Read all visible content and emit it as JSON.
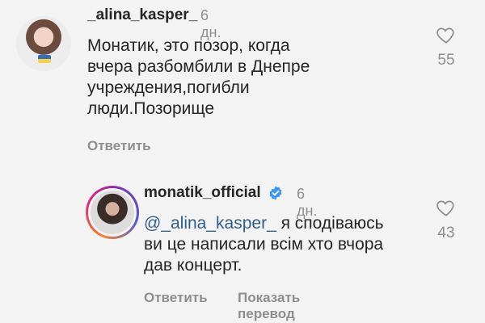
{
  "comment1": {
    "username": "_alina_kasper_",
    "time": "6 дн.",
    "text_lines": [
      "Монатик, это позор, когда",
      "вчера разбомбили в Днепре",
      "учреждения,погибли",
      "люди.Позорище"
    ],
    "reply_label": "Ответить",
    "likes": "55"
  },
  "comment2": {
    "username": "monatik_official",
    "time": "6 дн.",
    "mention": "@_alina_kasper_",
    "text_first_rest": " я сподіваюсь",
    "text_lines": [
      "ви це написали всім хто вчора",
      "дав концерт."
    ],
    "reply_label": "Ответить",
    "translate_label": "Показать перевод",
    "likes": "43"
  },
  "colors": {
    "background": "#f3f3f3",
    "text": "#262626",
    "secondary": "#8e8e8e",
    "mention": "#2f5f8f",
    "verified": "#3897f0"
  },
  "icons": [
    "heart-icon",
    "verified-badge-icon"
  ]
}
